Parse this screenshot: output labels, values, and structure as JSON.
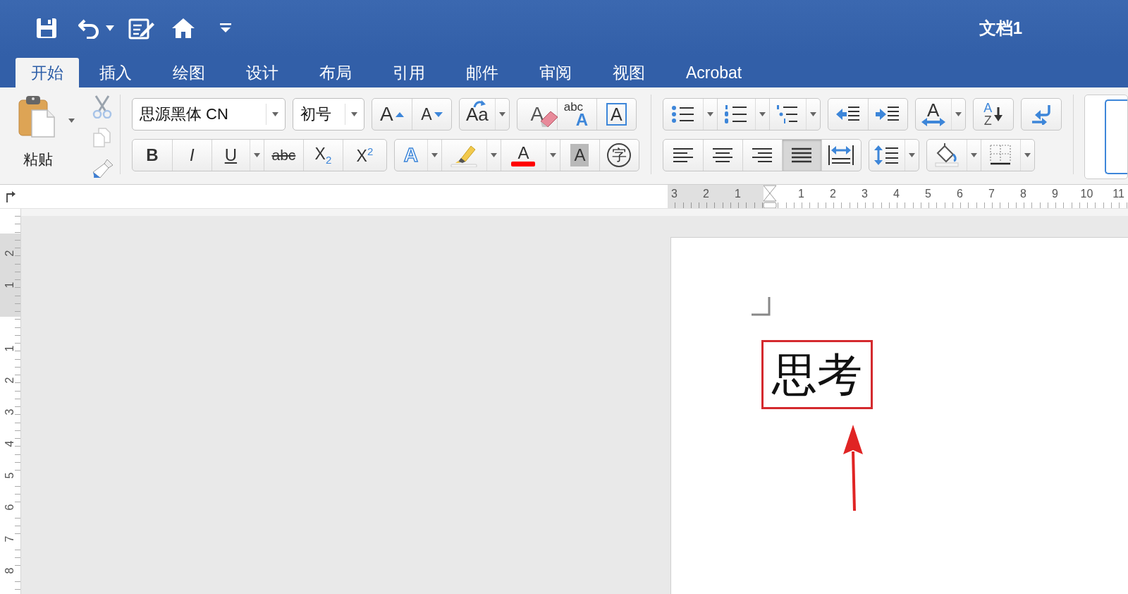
{
  "title_bar": {
    "title": "文档1"
  },
  "tabs": [
    {
      "label": "开始",
      "selected": true
    },
    {
      "label": "插入",
      "selected": false
    },
    {
      "label": "绘图",
      "selected": false
    },
    {
      "label": "设计",
      "selected": false
    },
    {
      "label": "布局",
      "selected": false
    },
    {
      "label": "引用",
      "selected": false
    },
    {
      "label": "邮件",
      "selected": false
    },
    {
      "label": "审阅",
      "selected": false
    },
    {
      "label": "视图",
      "selected": false
    },
    {
      "label": "Acrobat",
      "selected": false
    }
  ],
  "ribbon": {
    "paste": {
      "label": "粘贴"
    },
    "font": {
      "name": "思源黑体 CN",
      "size": "初号",
      "row1": [
        {
          "kind": "grow",
          "label": "A"
        },
        {
          "kind": "shrink",
          "label": "A"
        },
        {
          "kind": "change_case",
          "label": "Aa"
        },
        {
          "kind": "clear_format",
          "label": "A"
        },
        {
          "kind": "phonetic",
          "label": "abc",
          "sub": "A"
        },
        {
          "kind": "char_border",
          "label": "A"
        }
      ],
      "row2": [
        {
          "kind": "bold",
          "label": "B"
        },
        {
          "kind": "italic",
          "label": "I"
        },
        {
          "kind": "underline",
          "label": "U"
        },
        {
          "kind": "strikethrough",
          "label": "abc"
        },
        {
          "kind": "subscript",
          "label": "X$_{2}$"
        },
        {
          "kind": "superscript",
          "label": "X$^{2}$"
        },
        {
          "kind": "text_effects",
          "label": "A"
        },
        {
          "kind": "highlight"
        },
        {
          "kind": "font_color",
          "label": "A",
          "color": "#ff0000"
        },
        {
          "kind": "char_shading",
          "label": "A"
        },
        {
          "kind": "enclose",
          "label": "字"
        }
      ]
    },
    "paragraph": {
      "spacing_label": "A",
      "sort_labels": [
        "A",
        "Z"
      ],
      "alignment": [
        {
          "selected": false
        },
        {
          "selected": false
        },
        {
          "selected": false
        },
        {
          "selected": true
        },
        {
          "selected": false
        }
      ]
    }
  },
  "ruler": {
    "left_numbers": [
      "3",
      "2",
      "1"
    ],
    "right_numbers": [
      "1",
      "2",
      "3",
      "4",
      "5",
      "6",
      "7",
      "8",
      "9",
      "10",
      "11"
    ]
  },
  "vertical_ruler": {
    "top_numbers": [
      "2",
      "1"
    ],
    "numbers": [
      "1",
      "2",
      "3",
      "4",
      "5",
      "6",
      "7",
      "8"
    ]
  },
  "document": {
    "text": "思考"
  }
}
